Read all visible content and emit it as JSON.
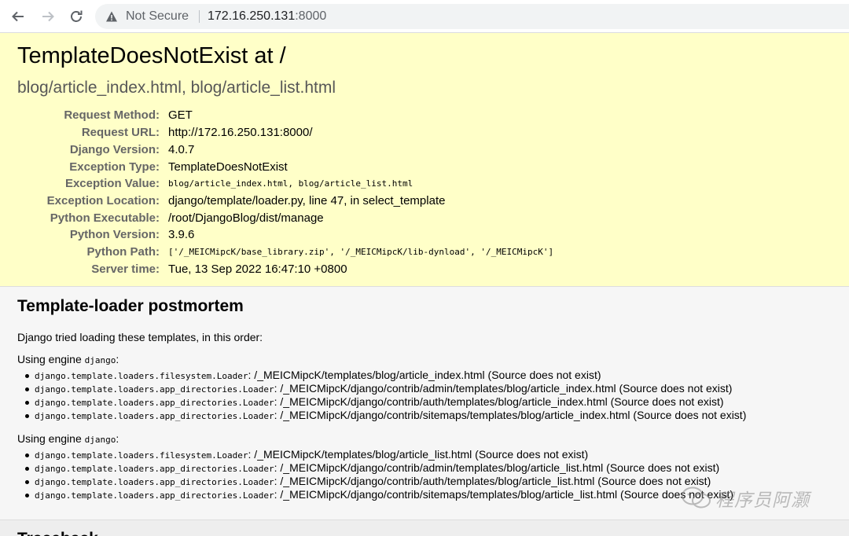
{
  "browser": {
    "security_label": "Not Secure",
    "url_host": "172.16.250.131",
    "url_port": ":8000"
  },
  "summary": {
    "title": "TemplateDoesNotExist at /",
    "subtitle": "blog/article_index.html, blog/article_list.html",
    "meta": [
      {
        "key": "Request Method:",
        "value": "GET"
      },
      {
        "key": "Request URL:",
        "value": "http://172.16.250.131:8000/"
      },
      {
        "key": "Django Version:",
        "value": "4.0.7"
      },
      {
        "key": "Exception Type:",
        "value": "TemplateDoesNotExist"
      },
      {
        "key": "Exception Value:",
        "value": "blog/article_index.html, blog/article_list.html"
      },
      {
        "key": "Exception Location:",
        "value": "django/template/loader.py, line 47, in select_template"
      },
      {
        "key": "Python Executable:",
        "value": "/root/DjangoBlog/dist/manage"
      },
      {
        "key": "Python Version:",
        "value": "3.9.6"
      },
      {
        "key": "Python Path:",
        "value": "['/_MEICMipcK/base_library.zip', '/_MEICMipcK/lib-dynload', '/_MEICMipcK']"
      },
      {
        "key": "Server time:",
        "value": "Tue, 13 Sep 2022 16:47:10 +0800"
      }
    ]
  },
  "postmortem": {
    "title": "Template-loader postmortem",
    "intro": "Django tried loading these templates, in this order:",
    "engine_prefix": "Using engine ",
    "engine_name": "django",
    "engine_suffix": ":",
    "groups": [
      {
        "items": [
          {
            "loader": "django.template.loaders.filesystem.Loader",
            "text": ": /_MEICMipcK/templates/blog/article_index.html (Source does not exist)"
          },
          {
            "loader": "django.template.loaders.app_directories.Loader",
            "text": ": /_MEICMipcK/django/contrib/admin/templates/blog/article_index.html (Source does not exist)"
          },
          {
            "loader": "django.template.loaders.app_directories.Loader",
            "text": ": /_MEICMipcK/django/contrib/auth/templates/blog/article_index.html (Source does not exist)"
          },
          {
            "loader": "django.template.loaders.app_directories.Loader",
            "text": ": /_MEICMipcK/django/contrib/sitemaps/templates/blog/article_index.html (Source does not exist)"
          }
        ]
      },
      {
        "items": [
          {
            "loader": "django.template.loaders.filesystem.Loader",
            "text": ": /_MEICMipcK/templates/blog/article_list.html (Source does not exist)"
          },
          {
            "loader": "django.template.loaders.app_directories.Loader",
            "text": ": /_MEICMipcK/django/contrib/admin/templates/blog/article_list.html (Source does not exist)"
          },
          {
            "loader": "django.template.loaders.app_directories.Loader",
            "text": ": /_MEICMipcK/django/contrib/auth/templates/blog/article_list.html (Source does not exist)"
          },
          {
            "loader": "django.template.loaders.app_directories.Loader",
            "text": ": /_MEICMipcK/django/contrib/sitemaps/templates/blog/article_list.html (Source does not exist)"
          }
        ]
      }
    ]
  },
  "traceback": {
    "title": "Traceback"
  },
  "watermark": {
    "text": "程序员阿灏"
  }
}
